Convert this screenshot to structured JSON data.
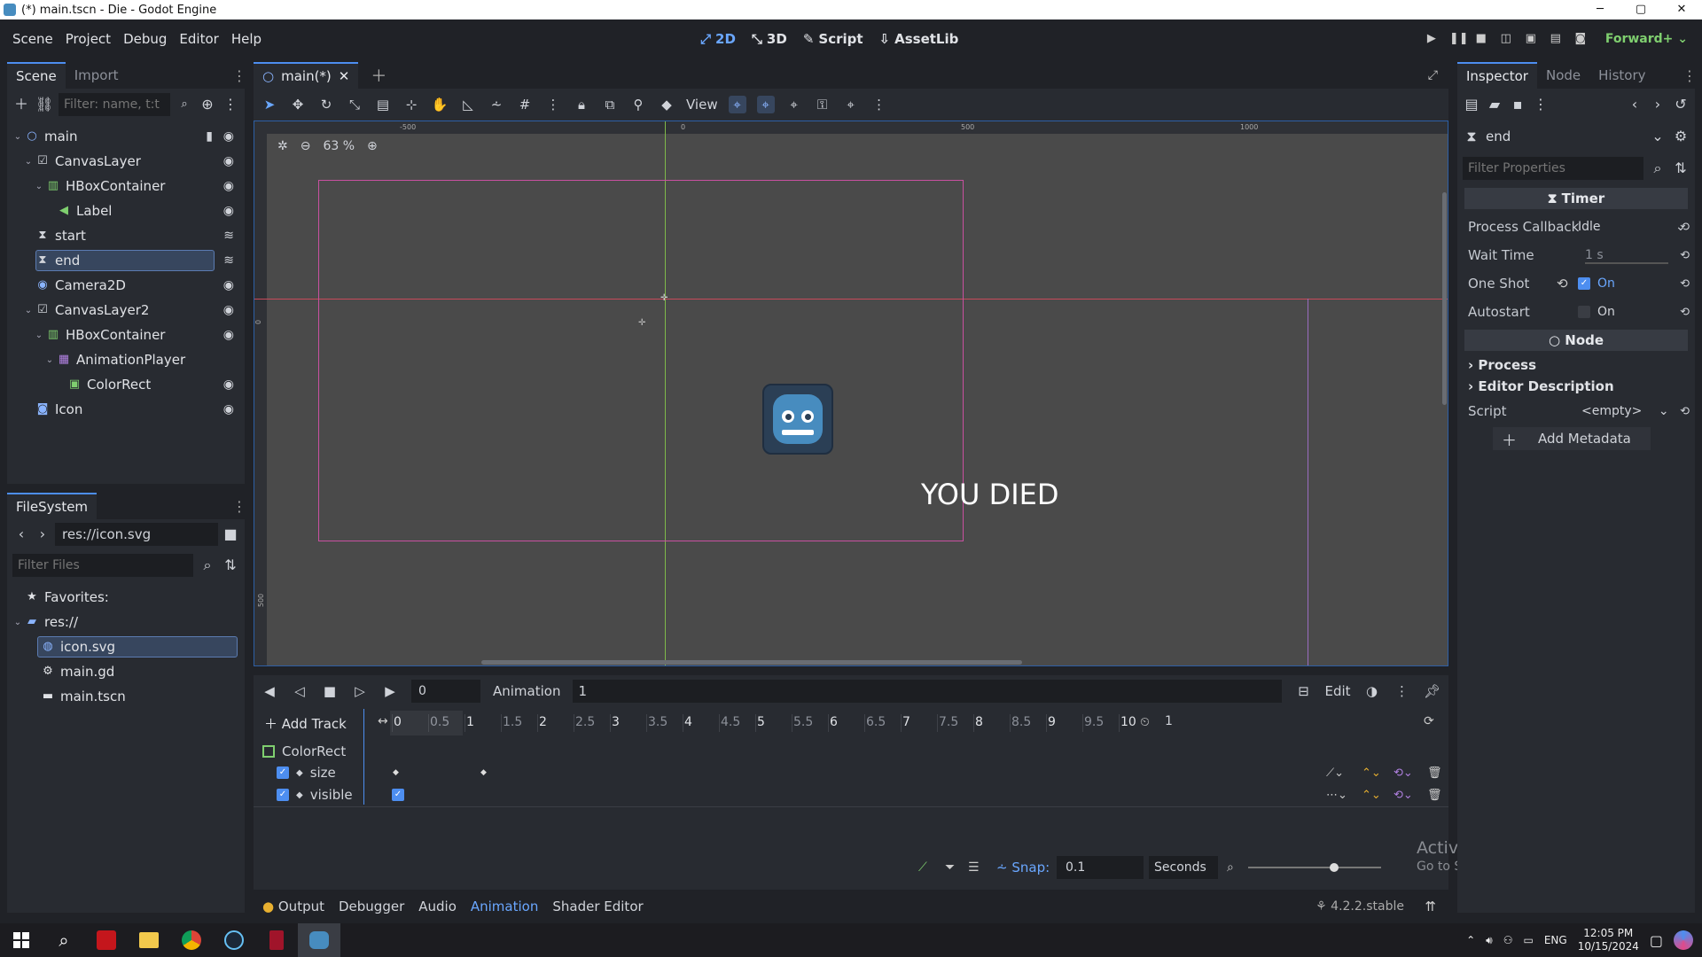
{
  "window": {
    "title": "(*) main.tscn - Die - Godot Engine",
    "controls": [
      "─",
      "▢",
      "✕"
    ]
  },
  "menu": {
    "items": [
      "Scene",
      "Project",
      "Debug",
      "Editor",
      "Help"
    ],
    "modes": [
      {
        "label": "2D",
        "icon": "2d-icon"
      },
      {
        "label": "3D",
        "icon": "3d-icon"
      },
      {
        "label": "Script",
        "icon": "script-icon"
      },
      {
        "label": "AssetLib",
        "icon": "assetlib-icon"
      }
    ],
    "active_mode": "2D",
    "renderer": "Forward+"
  },
  "scene_dock": {
    "tabs": [
      "Scene",
      "Import"
    ],
    "filter_placeholder": "Filter: name, t:t",
    "tree": [
      {
        "name": "main",
        "depth": 0,
        "icon": "node-icon",
        "arrow": "⌄",
        "vis": "eye",
        "script": true
      },
      {
        "name": "CanvasLayer",
        "depth": 1,
        "icon": "canvas-layer-icon",
        "arrow": "⌄",
        "vis": "eye"
      },
      {
        "name": "HBoxContainer",
        "depth": 2,
        "icon": "hbox-icon",
        "arrow": "⌄",
        "vis": "eye"
      },
      {
        "name": "Label",
        "depth": 3,
        "icon": "label-icon",
        "arrow": "",
        "vis": "eye"
      },
      {
        "name": "start",
        "depth": 1,
        "icon": "timer-icon",
        "arrow": "",
        "vis": "signal"
      },
      {
        "name": "end",
        "depth": 1,
        "icon": "timer-icon",
        "arrow": "",
        "vis": "signal",
        "selected": true
      },
      {
        "name": "Camera2D",
        "depth": 1,
        "icon": "camera-icon",
        "arrow": "",
        "vis": "eye"
      },
      {
        "name": "CanvasLayer2",
        "depth": 1,
        "icon": "canvas-layer-icon",
        "arrow": "⌄",
        "vis": "eye"
      },
      {
        "name": "HBoxContainer",
        "depth": 2,
        "icon": "hbox-icon",
        "arrow": "⌄",
        "vis": "eye"
      },
      {
        "name": "AnimationPlayer",
        "depth": 3,
        "icon": "animation-player-icon",
        "arrow": "⌄",
        "vis": ""
      },
      {
        "name": "ColorRect",
        "depth": 4,
        "icon": "color-rect-icon",
        "arrow": "",
        "vis": "eye"
      },
      {
        "name": "Icon",
        "depth": 1,
        "icon": "sprite-icon",
        "arrow": "",
        "vis": "eye"
      }
    ]
  },
  "filesystem": {
    "tab": "FileSystem",
    "path": "res://icon.svg",
    "filter_placeholder": "Filter Files",
    "items": [
      {
        "label": "Favorites:",
        "icon": "star-icon",
        "depth": 0,
        "arrow": ""
      },
      {
        "label": "res://",
        "icon": "folder-icon",
        "depth": 0,
        "arrow": "⌄"
      },
      {
        "label": "icon.svg",
        "icon": "svg-file-icon",
        "depth": 1,
        "arrow": "",
        "selected": true
      },
      {
        "label": "main.gd",
        "icon": "gear-icon",
        "depth": 1,
        "arrow": ""
      },
      {
        "label": "main.tscn",
        "icon": "scene-file-icon",
        "depth": 1,
        "arrow": ""
      }
    ]
  },
  "editor": {
    "doc_tab": "main(*)",
    "view_label": "View",
    "zoom": "63 %",
    "ruler_labels": [
      "-500",
      "0",
      "500",
      "1000"
    ],
    "ruler_left_labels": [
      "0",
      "500"
    ],
    "canvas_text": "YOU DIED"
  },
  "animation": {
    "time": "0",
    "label": "Animation",
    "selected": "1",
    "edit_label": "Edit",
    "add_track": "Add Track",
    "ticks": [
      "0",
      "0.5",
      "1",
      "1.5",
      "2",
      "2.5",
      "3",
      "3.5",
      "4",
      "4.5",
      "5",
      "5.5",
      "6",
      "6.5",
      "7",
      "7.5",
      "8",
      "8.5",
      "9",
      "9.5",
      "10"
    ],
    "length": "1",
    "track_group": "ColorRect",
    "tracks": [
      {
        "name": "size",
        "keys": [
          0,
          1
        ]
      },
      {
        "name": "visible",
        "keys": [
          0
        ]
      }
    ],
    "snap_label": "Snap:",
    "snap_value": "0.1",
    "snap_unit": "Seconds"
  },
  "bottom_tabs": [
    "Output",
    "Debugger",
    "Audio",
    "Animation",
    "Shader Editor"
  ],
  "active_bottom_tab": "Animation",
  "version": "4.2.2.stable",
  "inspector": {
    "tabs": [
      "Inspector",
      "Node",
      "History"
    ],
    "object": "end",
    "filter_placeholder": "Filter Properties",
    "class": "Timer",
    "props": [
      {
        "label": "Process Callback",
        "value": "Idle"
      },
      {
        "label": "Wait Time",
        "value": "1 s"
      },
      {
        "label": "One Shot",
        "value": "On",
        "checked": true
      },
      {
        "label": "Autostart",
        "value": "On",
        "checked": false
      }
    ],
    "node_section": "Node",
    "groups": [
      "Process",
      "Editor Description"
    ],
    "script_label": "Script",
    "script_value": "<empty>",
    "add_metadata": "Add Metadata"
  },
  "watermark": {
    "line1": "Activate Windows",
    "line2": "Go to Settings to activate Windows."
  },
  "taskbar": {
    "lang": "ENG",
    "time": "12:05 PM",
    "date": "10/15/2024"
  },
  "colors": {
    "accent": "#4d8ef0",
    "canvas_bg": "#4a4a4a",
    "frame_rect": "#c850a0"
  }
}
